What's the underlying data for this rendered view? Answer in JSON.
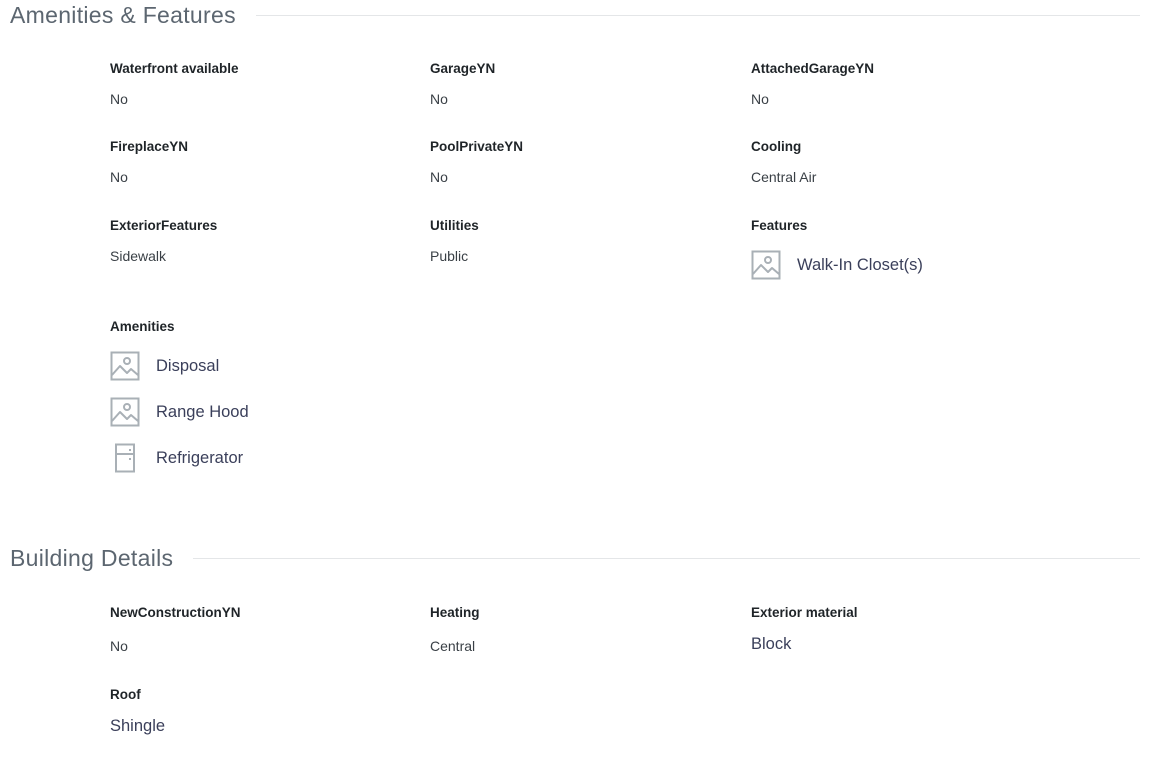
{
  "amenities_section": {
    "title": "Amenities & Features",
    "fields": {
      "waterfront": {
        "label": "Waterfront available",
        "value": "No"
      },
      "garage": {
        "label": "GarageYN",
        "value": "No"
      },
      "attached_garage": {
        "label": "AttachedGarageYN",
        "value": "No"
      },
      "fireplace": {
        "label": "FireplaceYN",
        "value": "No"
      },
      "pool_private": {
        "label": "PoolPrivateYN",
        "value": "No"
      },
      "cooling": {
        "label": "Cooling",
        "value": "Central Air"
      },
      "exterior_features": {
        "label": "ExteriorFeatures",
        "value": "Sidewalk"
      },
      "utilities": {
        "label": "Utilities",
        "value": "Public"
      }
    },
    "features": {
      "label": "Features",
      "items": [
        {
          "label": "Walk-In Closet(s)",
          "icon": "image-placeholder-icon"
        }
      ]
    },
    "amenities": {
      "label": "Amenities",
      "items": [
        {
          "label": "Disposal",
          "icon": "image-placeholder-icon"
        },
        {
          "label": "Range Hood",
          "icon": "image-placeholder-icon"
        },
        {
          "label": "Refrigerator",
          "icon": "refrigerator-icon"
        }
      ]
    }
  },
  "building_section": {
    "title": "Building Details",
    "fields": {
      "new_construction": {
        "label": "NewConstructionYN",
        "value": "No"
      },
      "heating": {
        "label": "Heating",
        "value": "Central"
      },
      "exterior_material": {
        "label": "Exterior material",
        "value": "Block"
      },
      "roof": {
        "label": "Roof",
        "value": "Shingle"
      }
    }
  },
  "colors": {
    "icon_gray": "#a9b0b6",
    "heading_gray": "#5c6670",
    "rule": "#e4e6e8"
  }
}
